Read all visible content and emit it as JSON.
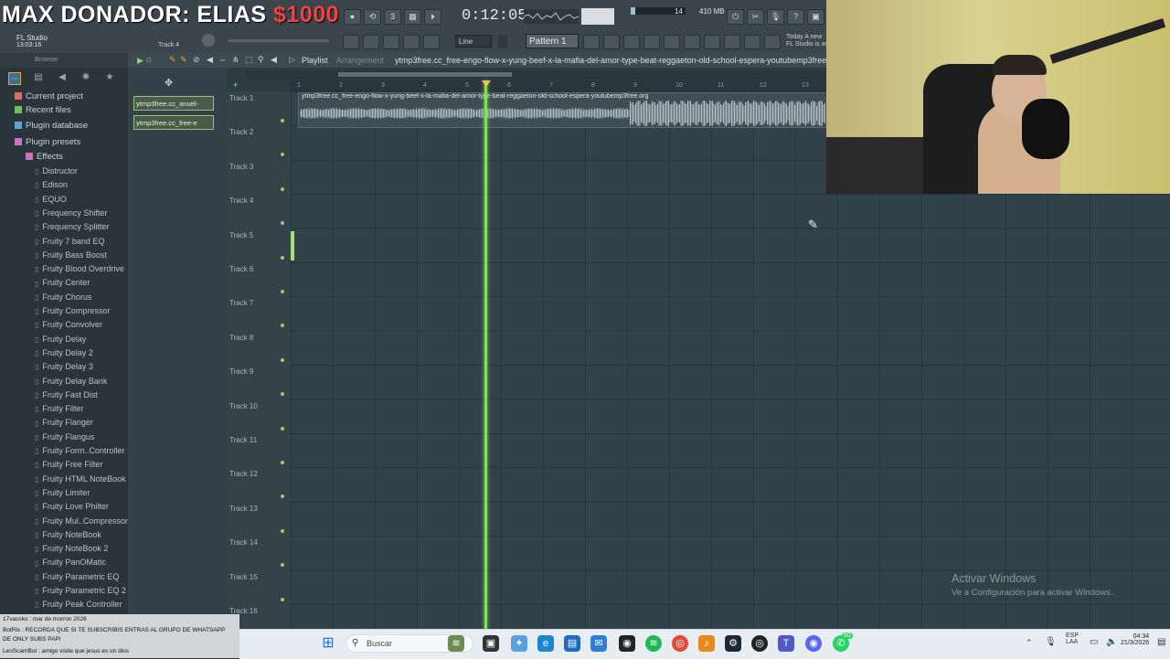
{
  "overlay": {
    "title": "MAX DONADOR: ELIAS",
    "amount": "$1000"
  },
  "transport": {
    "time": "0:12:05"
  },
  "status": {
    "cpu": "14",
    "memory": "410 MB"
  },
  "info": {
    "app": "FL Studio",
    "app_time": "13:03:16",
    "track": "Track 4"
  },
  "news": {
    "line1": "Today  A new",
    "line2": "FL Studio is av"
  },
  "toolbar": {
    "snap": "Line",
    "pattern": "Pattern 1"
  },
  "browser": {
    "header": "Browser",
    "sections": [
      {
        "label": "Current project",
        "icon": "folder-icon",
        "color": "#e06a6a"
      },
      {
        "label": "Recent files",
        "icon": "folder-icon",
        "color": "#6fbf5a"
      },
      {
        "label": "Plugin database",
        "icon": "database-icon",
        "color": "#5aa4d6"
      },
      {
        "label": "Plugin presets",
        "icon": "preset-icon",
        "color": "#d06fc2"
      }
    ],
    "effects_label": "Effects",
    "effects": [
      "Distructor",
      "Edison",
      "EQUO",
      "Frequency Shifter",
      "Frequency Splitter",
      "Fruity 7 band EQ",
      "Fruity Bass Boost",
      "Fruity Blood Overdrive",
      "Fruity Center",
      "Fruity Chorus",
      "Fruity Compressor",
      "Fruity Convolver",
      "Fruity Delay",
      "Fruity Delay 2",
      "Fruity Delay 3",
      "Fruity Delay Bank",
      "Fruity Fast Dist",
      "Fruity Filter",
      "Fruity Flanger",
      "Fruity Flangus",
      "Fruity Form..Controller",
      "Fruity Free Filter",
      "Fruity HTML NoteBook",
      "Fruity Limiter",
      "Fruity Love Philter",
      "Fruity Mul..Compressor",
      "Fruity NoteBook",
      "Fruity NoteBook 2",
      "Fruity PanOMatic",
      "Fruity Parametric EQ",
      "Fruity Parametric EQ 2",
      "Fruity Peak Controller"
    ]
  },
  "clips_picker": [
    "ytmp3free.cc_anuel-",
    "ytmp3free.cc_free-e"
  ],
  "playlist": {
    "title": "Playlist",
    "arrangement": "Arrangement",
    "file": "ytmp3free.cc_free-engo-flow-x-yung-beef-x-la-mafia-del-amor-type-beat-reggaeton-old-school-espera-youtubemp3free.org",
    "clip_name": "ytmp3free.cc_free-engo-flow-x-yung-beef-x-la-mafia-del-amor-type-beat-reggaeton-old-school-espera-youtubemp3free.org",
    "tracks": [
      "Track 1",
      "Track 2",
      "Track 3",
      "Track 4",
      "Track 5",
      "Track 6",
      "Track 7",
      "Track 8",
      "Track 9",
      "Track 10",
      "Track 11",
      "Track 12",
      "Track 13",
      "Track 14",
      "Track 15",
      "Track 16"
    ],
    "bars": [
      "1",
      "2",
      "3",
      "4",
      "5",
      "6",
      "7",
      "8",
      "9",
      "10",
      "11",
      "12",
      "13"
    ]
  },
  "watermark": {
    "line1": "Activar Windows",
    "line2": "Ve a Configuración para activar Windows."
  },
  "chat": [
    "17vassko : mar de morron 2026",
    "BotRix : RECORDA QUE SI TE SUBSCRIBIS ENTRAS AL GRUPO DE WHATSAPP",
    "DE ONLY SUBS PAPI",
    "LeoScamBot : amigo visite que jesus es un dios"
  ],
  "taskbar": {
    "search": "Buscar",
    "lang1": "ESP",
    "lang2": "LAA",
    "time": "04:34",
    "date": "21/3/2026",
    "badge": "60"
  }
}
